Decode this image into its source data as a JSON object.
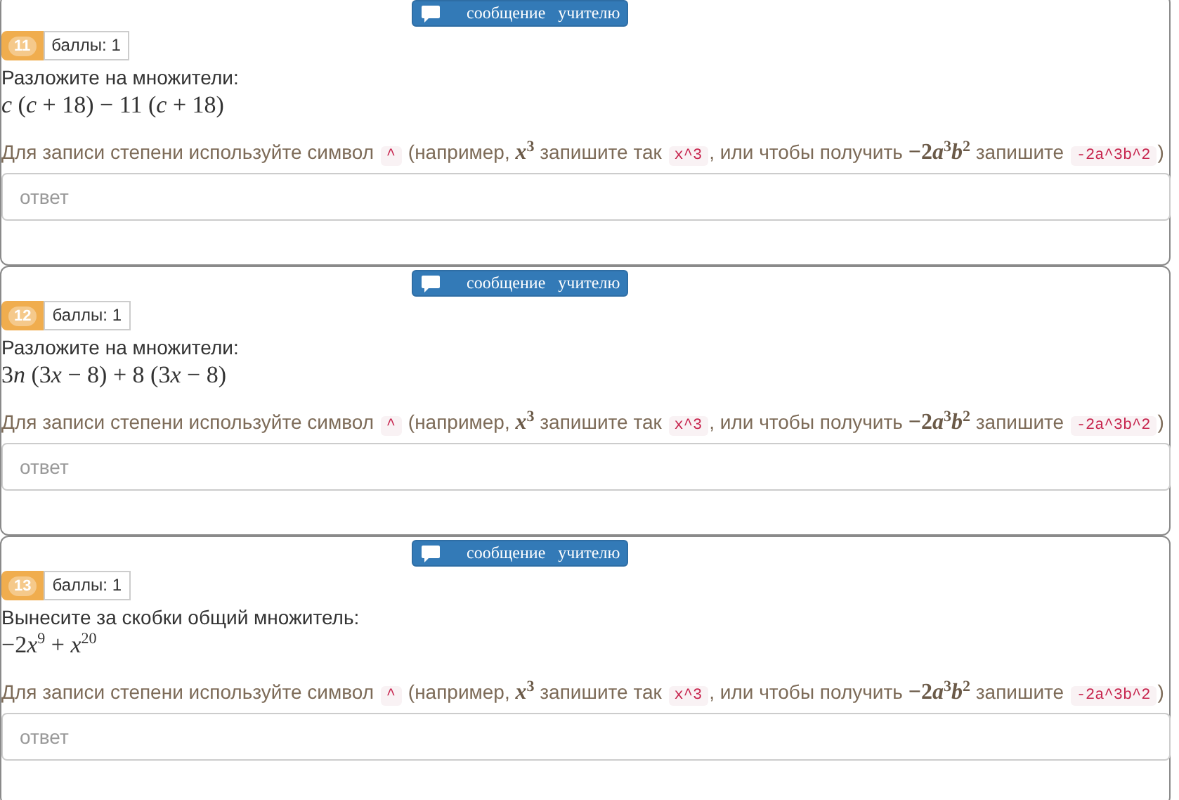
{
  "tasks": [
    {
      "message_button": {
        "label_1": "сообщение",
        "label_2": "учителю"
      },
      "number": "11",
      "points": "баллы: 1",
      "prompt": "Разложите на множители:",
      "formula": [
        {
          "kind": "var",
          "text": "c"
        },
        {
          "kind": "op",
          "text": " ("
        },
        {
          "kind": "var",
          "text": "c"
        },
        {
          "kind": "op",
          "text": " + 18) − 11 ("
        },
        {
          "kind": "var",
          "text": "c"
        },
        {
          "kind": "op",
          "text": " + 18)"
        }
      ],
      "hint": [
        {
          "kind": "text",
          "text": "Для записи степени используйте символ "
        },
        {
          "kind": "code",
          "text": "^"
        },
        {
          "kind": "text",
          "text": " (например, "
        },
        {
          "kind": "var",
          "text": "x"
        },
        {
          "kind": "sup",
          "text": "3"
        },
        {
          "kind": "text",
          "text": " запишите так "
        },
        {
          "kind": "code",
          "text": "x^3"
        },
        {
          "kind": "text",
          "text": ", или чтобы получить "
        },
        {
          "kind": "op",
          "text": "−2"
        },
        {
          "kind": "var",
          "text": "a"
        },
        {
          "kind": "sup",
          "text": "3"
        },
        {
          "kind": "var",
          "text": "b"
        },
        {
          "kind": "sup",
          "text": "2"
        },
        {
          "kind": "text",
          "text": " запишите "
        },
        {
          "kind": "code",
          "text": "-2a^3b^2"
        },
        {
          "kind": "text",
          "text": ")"
        }
      ],
      "answer": {
        "placeholder": "ответ"
      }
    },
    {
      "message_button": {
        "label_1": "сообщение",
        "label_2": "учителю"
      },
      "number": "12",
      "points": "баллы: 1",
      "prompt": "Разложите на множители:",
      "formula": [
        {
          "kind": "op",
          "text": "3"
        },
        {
          "kind": "var",
          "text": "n"
        },
        {
          "kind": "op",
          "text": " (3"
        },
        {
          "kind": "var",
          "text": "x"
        },
        {
          "kind": "op",
          "text": " − 8) + 8 (3"
        },
        {
          "kind": "var",
          "text": "x"
        },
        {
          "kind": "op",
          "text": " − 8)"
        }
      ],
      "hint": [
        {
          "kind": "text",
          "text": "Для записи степени используйте символ "
        },
        {
          "kind": "code",
          "text": "^"
        },
        {
          "kind": "text",
          "text": " (например, "
        },
        {
          "kind": "var",
          "text": "x"
        },
        {
          "kind": "sup",
          "text": "3"
        },
        {
          "kind": "text",
          "text": " запишите так "
        },
        {
          "kind": "code",
          "text": "x^3"
        },
        {
          "kind": "text",
          "text": ", или чтобы получить "
        },
        {
          "kind": "op",
          "text": "−2"
        },
        {
          "kind": "var",
          "text": "a"
        },
        {
          "kind": "sup",
          "text": "3"
        },
        {
          "kind": "var",
          "text": "b"
        },
        {
          "kind": "sup",
          "text": "2"
        },
        {
          "kind": "text",
          "text": " запишите "
        },
        {
          "kind": "code",
          "text": "-2a^3b^2"
        },
        {
          "kind": "text",
          "text": ")"
        }
      ],
      "answer": {
        "placeholder": "ответ"
      }
    },
    {
      "message_button": {
        "label_1": "сообщение",
        "label_2": "учителю"
      },
      "number": "13",
      "points": "баллы: 1",
      "prompt": "Вынесите за скобки общий множитель:",
      "formula": [
        {
          "kind": "op",
          "text": "−2"
        },
        {
          "kind": "var",
          "text": "x"
        },
        {
          "kind": "sup",
          "text": "9"
        },
        {
          "kind": "op",
          "text": " + "
        },
        {
          "kind": "var",
          "text": "x"
        },
        {
          "kind": "sup",
          "text": "20"
        }
      ],
      "hint": [
        {
          "kind": "text",
          "text": "Для записи степени используйте символ "
        },
        {
          "kind": "code",
          "text": "^"
        },
        {
          "kind": "text",
          "text": " (например, "
        },
        {
          "kind": "var",
          "text": "x"
        },
        {
          "kind": "sup",
          "text": "3"
        },
        {
          "kind": "text",
          "text": " запишите так "
        },
        {
          "kind": "code",
          "text": "x^3"
        },
        {
          "kind": "text",
          "text": ", или чтобы получить "
        },
        {
          "kind": "op",
          "text": "−2"
        },
        {
          "kind": "var",
          "text": "a"
        },
        {
          "kind": "sup",
          "text": "3"
        },
        {
          "kind": "var",
          "text": "b"
        },
        {
          "kind": "sup",
          "text": "2"
        },
        {
          "kind": "text",
          "text": " запишите "
        },
        {
          "kind": "code",
          "text": "-2a^3b^2"
        },
        {
          "kind": "text",
          "text": ")"
        }
      ],
      "answer": {
        "placeholder": "ответ"
      }
    }
  ]
}
